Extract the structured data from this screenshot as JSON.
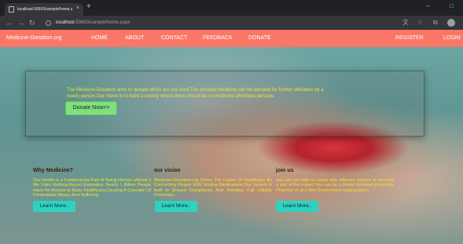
{
  "browser": {
    "tab_title": "localhost:50663/sample/home.asp",
    "tab_close": "×",
    "new_tab": "+",
    "url_host": "localhost",
    "url_path": ":50663/sample/home.aspx",
    "window_controls": [
      "–",
      "□"
    ],
    "toolbar_icons": [
      "translate-icon",
      "star-icon",
      "extensions-icon",
      "profile-icon"
    ]
  },
  "navbar": {
    "brand": "Medicine-Donation.org",
    "links": [
      "HOME",
      "ABOUT",
      "CONTACT",
      "FEEDBACK",
      "DONATE"
    ],
    "register": "REGISTER",
    "login": "LOGIN",
    "color": "#fa7768"
  },
  "hero": {
    "text_line1": "The Medicine-Donation aims to donate which are not used.The donated medicine can be donated for further utilization by a",
    "text_line2": "needy person.Our vision is to build a society where there should be no medicine affordless persons",
    "button": "Donate Now>>"
  },
  "columns": [
    {
      "title": "Why Medicine?",
      "text": "Our Health is a Fundamental Part of Being Human without it We Faint Nothing.Report Estimates, Nearly 1 Billion People Have No Access to Basic Healthcare,Causing A Cascade Of Preventable Misery And Suffering.",
      "button": "Learn More.."
    },
    {
      "title": "our vision",
      "text": "Medicine-Donation.org Drives The Future Of Healthcare By Connecting People With Surplus Medications.Our System is built to Ensure Compliance And Provides Full Liability Protection.",
      "button": "Learn More.."
    },
    {
      "title": "join us",
      "text": "you can join with us easily with different aspects to become a part of the impact.You can be a Donor,Volunteer,Executive Pharmist or any Non Government organizations.",
      "button": "Learn More.."
    }
  ],
  "colors": {
    "hero_text": "#f5e427",
    "donate_button": "#7ee07e",
    "learn_button": "#2ed3c0",
    "column_title": "#3a1d0b"
  }
}
